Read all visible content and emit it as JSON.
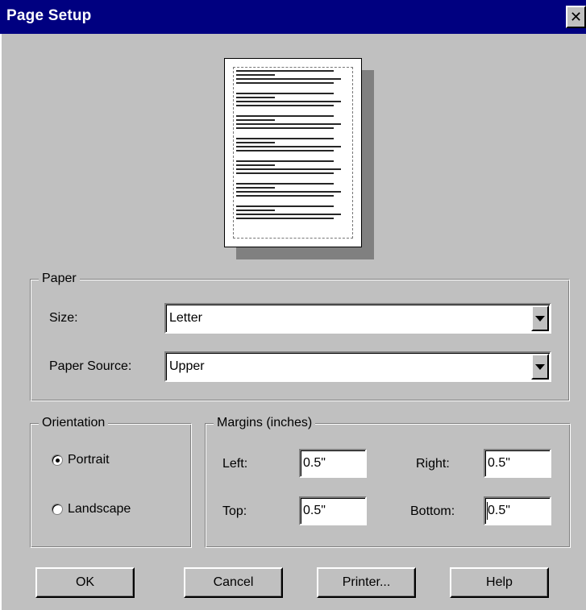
{
  "window": {
    "title": "Page Setup",
    "close_glyph": "✕"
  },
  "paper": {
    "group_label": "Paper",
    "size_label": "Size:",
    "size_value": "Letter",
    "source_label": "Paper Source:",
    "source_value": "Upper"
  },
  "orientation": {
    "group_label": "Orientation",
    "portrait_label": "Portrait",
    "landscape_label": "Landscape",
    "selected": "Portrait"
  },
  "margins": {
    "group_label": "Margins (inches)",
    "left_label": "Left:",
    "left_value": "0.5\"",
    "right_label": "Right:",
    "right_value": "0.5\"",
    "top_label": "Top:",
    "top_value": "0.5\"",
    "bottom_label": "Bottom:",
    "bottom_value": "0.5\""
  },
  "buttons": {
    "ok": "OK",
    "cancel": "Cancel",
    "printer": "Printer...",
    "help": "Help"
  },
  "icons": {
    "dropdown": "chevron-down-icon",
    "close": "close-icon"
  }
}
